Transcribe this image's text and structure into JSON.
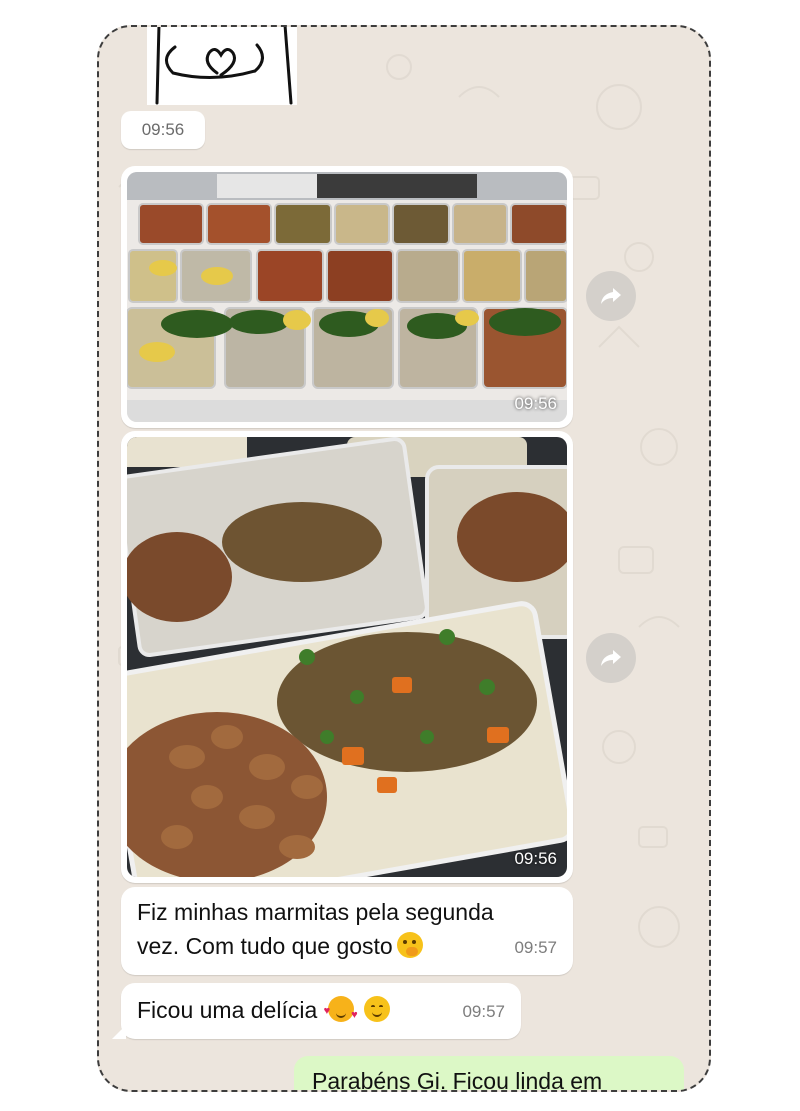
{
  "chat": {
    "sticker_time": "09:56",
    "photo1_time": "09:56",
    "photo2_time": "09:56",
    "msg1": {
      "line1": "Fiz minhas marmitas pela segunda",
      "line2": "vez. Com tudo que gosto",
      "emoji": "face-with-hand-over-mouth-emoji",
      "time": "09:57"
    },
    "msg2": {
      "text": "Ficou uma delícia",
      "emojis": [
        "smiling-face-with-hearts-emoji",
        "smiling-face-emoji"
      ],
      "time": "09:57"
    },
    "reply_preview": "Parabéns Gi. Ficou linda em"
  },
  "colors": {
    "chat_bg": "#ece5dd",
    "incoming_bubble": "#ffffff",
    "outgoing_bubble": "#dcf8c6",
    "timestamp": "#7d7d7d"
  },
  "icons": {
    "forward": "forward-arrow-icon"
  }
}
